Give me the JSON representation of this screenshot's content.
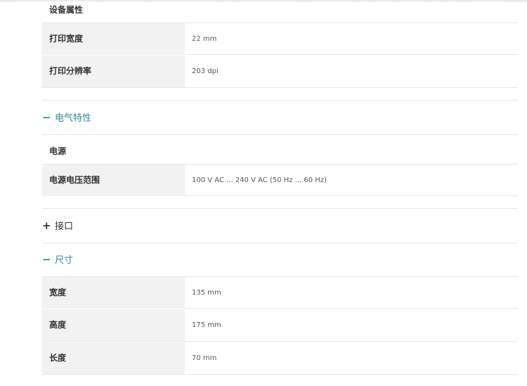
{
  "top_group": {
    "title": "设备属性"
  },
  "device_rows": [
    {
      "label": "打印宽度",
      "value": "22 mm"
    },
    {
      "label": "打印分辨率",
      "value": "203 dpi"
    }
  ],
  "sections": {
    "electrical": {
      "sign": "−",
      "title": "电气特性"
    },
    "interface": {
      "sign": "+",
      "title": "接口"
    },
    "dimensions": {
      "sign": "−",
      "title": "尺寸"
    }
  },
  "power_group": {
    "title": "电源"
  },
  "power_rows": [
    {
      "label": "电源电压范围",
      "value": "100 V AC ... 240 V AC (50 Hz ... 60 Hz)"
    }
  ],
  "dimension_rows": [
    {
      "label": "宽度",
      "value": "135 mm"
    },
    {
      "label": "高度",
      "value": "175 mm"
    },
    {
      "label": "长度",
      "value": "70 mm"
    }
  ],
  "colors": {
    "accent": "#2a8a9b",
    "label_bg": "#f2f2f2",
    "divider": "#e6e6e6"
  }
}
